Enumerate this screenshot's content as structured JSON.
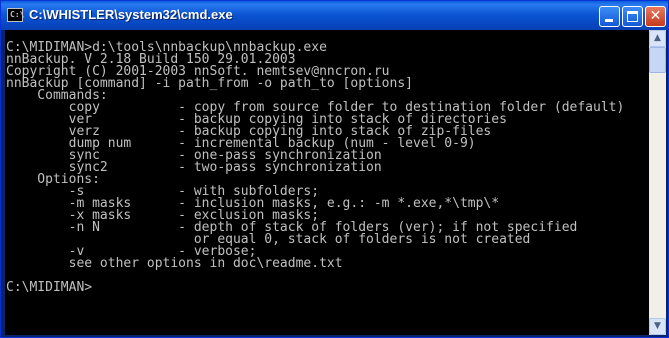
{
  "window": {
    "title": "C:\\WHISTLER\\system32\\cmd.exe",
    "icon_text": "C:\\"
  },
  "icons": {
    "app": "command-prompt-icon",
    "minimize": "minimize-icon",
    "maximize": "maximize-icon",
    "close": "close-icon",
    "scroll_up": "scroll-up-arrow-icon",
    "scroll_down": "scroll-down-arrow-icon"
  },
  "titlebar": {
    "minimize_glyph": "",
    "close_glyph": "✕"
  },
  "scrollbar": {
    "up_glyph": "▲",
    "down_glyph": "▼"
  },
  "console": {
    "lines": [
      "C:\\MIDIMAN>d:\\tools\\nnbackup\\nnbackup.exe",
      "nnBackup. V 2.18 Build 150 29.01.2003",
      "Copyright (C) 2001-2003 nnSoft. nemtsev@nncron.ru",
      "nnBackup [command] -i path_from -o path_to [options]",
      "    Commands:",
      "        copy          - copy from source folder to destination folder (default)",
      "        ver           - backup copying into stack of directories",
      "        verz          - backup copying into stack of zip-files",
      "        dump num      - incremental backup (num - level 0-9)",
      "        sync          - one-pass synchronization",
      "        sync2         - two-pass synchronization",
      "    Options:",
      "        -s            - with subfolders;",
      "        -m masks      - inclusion masks, e.g.: -m *.exe,*\\tmp\\*",
      "        -x masks      - exclusion masks;",
      "        -n N          - depth of stack of folders (ver); if not specified",
      "                        or equal 0, stack of folders is not created",
      "        -v            - verbose;",
      "        see other options in doc\\readme.txt",
      "",
      "C:\\MIDIMAN>"
    ]
  }
}
